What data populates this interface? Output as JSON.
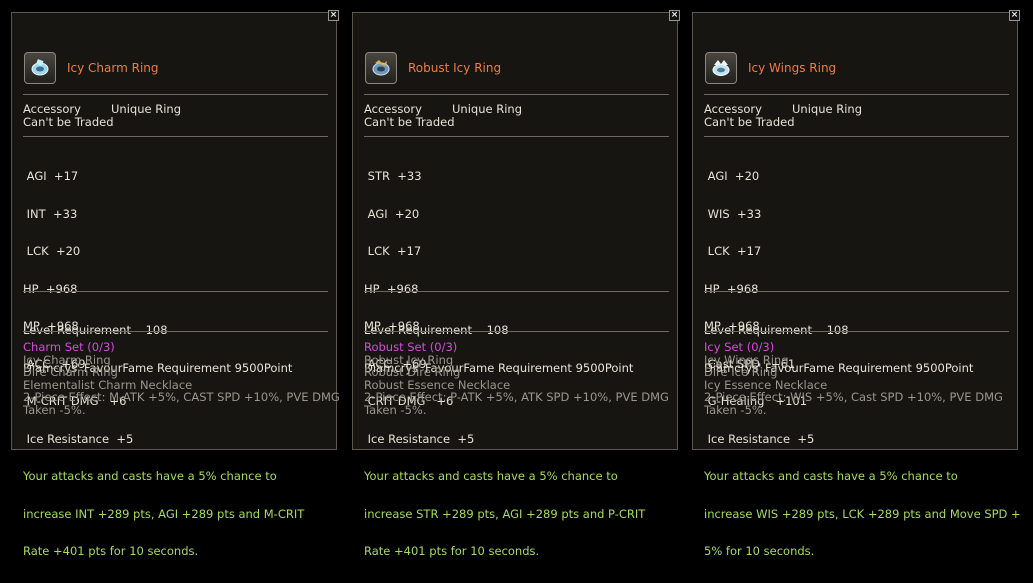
{
  "colors": {
    "item_name": "#ef7d3c",
    "effect_text": "#a6da5f",
    "set_title": "#d14ed8",
    "set_text": "#9a968c"
  },
  "tooltips": [
    {
      "close_icon": "close-icon",
      "name": "Icy Charm Ring",
      "category": "Accessory",
      "subtype": "Unique Ring",
      "trade": "Can't be Traded",
      "stats": [
        " AGI  +17",
        " INT  +33",
        " LCK  +20",
        "HP  +968",
        "MP  +968",
        " ACC   +69",
        " M-CRIT DMG   +6",
        " Ice Resistance  +5"
      ],
      "effect": [
        "Your attacks and casts have a 5% chance to",
        "increase INT +289 pts, AGI +289 pts and M-CRIT",
        "Rate +401 pts for 10 seconds."
      ],
      "level_req": "Level Requirement    108",
      "fame_req": "Diamcrys' FavourFame Requirement 9500Point",
      "set_name": "Charm Set (0/3)",
      "set_items": [
        "Icy Charm Ring",
        "Dire Charm Ring",
        "Elementalist Charm Necklace"
      ],
      "set_effect": [
        "2-Piece Effect: M-ATK +5%, CAST SPD +10%, PVE DMG",
        "Taken -5%."
      ]
    },
    {
      "close_icon": "close-icon",
      "name": "Robust Icy Ring",
      "category": "Accessory",
      "subtype": "Unique Ring",
      "trade": "Can't be Traded",
      "stats": [
        " STR  +33",
        " AGI  +20",
        " LCK  +17",
        "HP  +968",
        "MP  +968",
        " ACC   +69",
        " CRIT DMG   +6",
        " Ice Resistance  +5"
      ],
      "effect": [
        "Your attacks and casts have a 5% chance to",
        "increase STR +289 pts, AGI +289 pts and P-CRIT",
        "Rate +401 pts for 10 seconds."
      ],
      "level_req": "Level Requirement    108",
      "fame_req": "Diamcrys' FavourFame Requirement 9500Point",
      "set_name": "Robust Set (0/3)",
      "set_items": [
        "Robust Icy Ring",
        "Robust Dire Ring",
        "Robust Essence Necklace"
      ],
      "set_effect": [
        "2-Piece Effect: P-ATK +5%, ATK SPD +10%, PVE DMG",
        "Taken -5%."
      ]
    },
    {
      "close_icon": "close-icon",
      "name": "Icy Wings Ring",
      "category": "Accessory",
      "subtype": "Unique Ring",
      "trade": "Can't be Traded",
      "stats": [
        " AGI  +20",
        " WIS  +33",
        " LCK  +17",
        "HP  +968",
        "MP  +968",
        " Cast SPD   +61",
        " G-Healing   +101",
        " Ice Resistance  +5"
      ],
      "effect": [
        "Your attacks and casts have a 5% chance to",
        "increase WIS +289 pts, LCK +289 pts and Move SPD +",
        "5% for 10 seconds."
      ],
      "level_req": "Level Requirement    108",
      "fame_req": "Diamcrys' FavourFame Requirement 9500Point",
      "set_name": "Icy Set (0/3)",
      "set_items": [
        "Icy Wings Ring",
        "Dire Ice Ring",
        "Icy Essence Necklace"
      ],
      "set_effect": [
        "2-Piece Effect: WIS +5%, Cast SPD +10%, PVE DMG",
        "Taken -5%."
      ]
    }
  ]
}
